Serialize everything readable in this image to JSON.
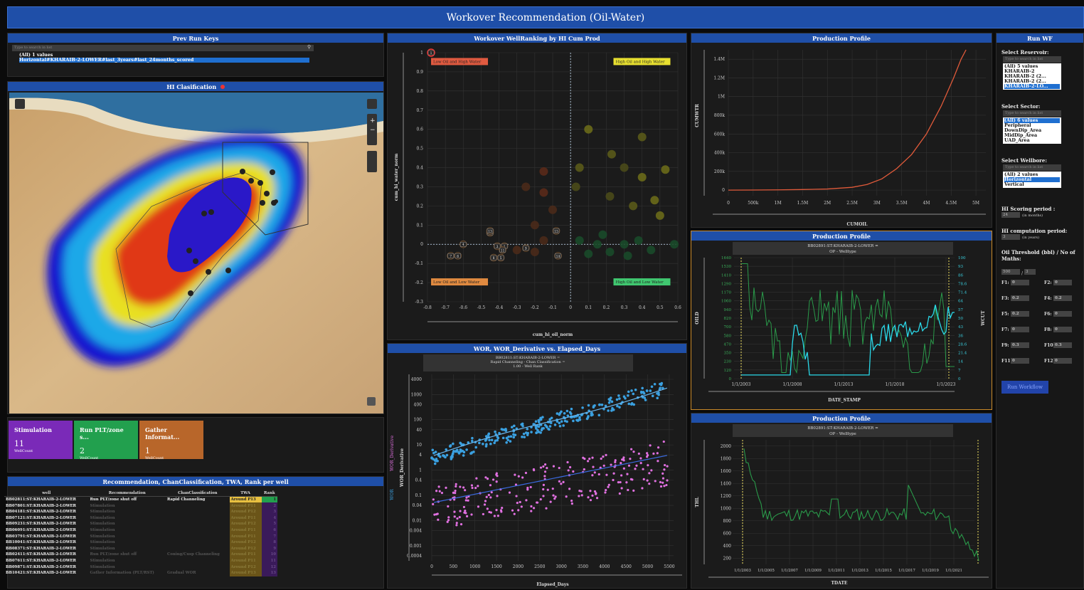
{
  "title": "Workover Recommendation (Oil-Water)",
  "prev_run": {
    "title": "Prev Run Keys",
    "search": "Type to search in list",
    "items": [
      "(All) 1 values",
      "Horizontal#KHARAIB-2-LOWER#last_3years#last_24months_scored"
    ]
  },
  "map": {
    "title": "HI Clasification"
  },
  "cards": [
    {
      "title": "Stimulation",
      "value": "11",
      "sub": "WellCount",
      "color": "#7a2ab8"
    },
    {
      "title": "Run PLT/zone s...",
      "value": "2",
      "sub": "WellCount",
      "color": "#22a04e"
    },
    {
      "title": "Gather Informat...",
      "value": "1",
      "sub": "WellCount",
      "color": "#b8662a"
    }
  ],
  "table": {
    "title": "Recommendation, ChanClassification, TWA, Rank per well",
    "headers": [
      "well",
      "Recommendation",
      "ChanClassification",
      "TWA",
      "Rank"
    ],
    "rows": [
      {
        "well": "BB02811:ST:KHARAIB-2-LOWER",
        "rec": "Run PLT/zone shut off",
        "chan": "Rapid Channeling",
        "twa": "Around P13",
        "rank": "1"
      },
      {
        "well": "BB07801:ST:KHARAIB-2-LOWER",
        "rec": "Stimulation",
        "chan": "",
        "twa": "Around P11",
        "rank": "2"
      },
      {
        "well": "BB04181:ST:KHARAIB-2-LOWER",
        "rec": "Stimulation",
        "chan": "",
        "twa": "Around P12",
        "rank": "3"
      },
      {
        "well": "BB07121:ST:KHARAIB-2-LOWER",
        "rec": "Stimulation",
        "chan": "",
        "twa": "Around P11",
        "rank": "4"
      },
      {
        "well": "BB09231:ST:KHARAIB-2-LOWER",
        "rec": "Stimulation",
        "chan": "",
        "twa": "Around P12",
        "rank": "5"
      },
      {
        "well": "BB06091:ST:KHARAIB-2-LOWER",
        "rec": "Stimulation",
        "chan": "",
        "twa": "Around P11",
        "rank": "6"
      },
      {
        "well": "BB03791:ST:KHARAIB-2-LOWER",
        "rec": "Stimulation",
        "chan": "",
        "twa": "Around P11",
        "rank": "7"
      },
      {
        "well": "BB10041:ST:KHARAIB-2-LOWER",
        "rec": "Stimulation",
        "chan": "",
        "twa": "Around P12",
        "rank": "8"
      },
      {
        "well": "BB08371:ST:KHARAIB-2-LOWER",
        "rec": "Stimulation",
        "chan": "",
        "twa": "Around P12",
        "rank": "9"
      },
      {
        "well": "BB02411:ST:KHARAIB-2-LOWER",
        "rec": "Run PLT/zone shut off",
        "chan": "Coning/Cusp Channeling",
        "twa": "Around P11",
        "rank": "10"
      },
      {
        "well": "BB07611:ST:KHARAIB-2-LOWER",
        "rec": "Stimulation",
        "chan": "",
        "twa": "Around P11",
        "rank": "11"
      },
      {
        "well": "BB09871:ST:KHARAIB-2-LOWER",
        "rec": "Stimulation",
        "chan": "",
        "twa": "Around P12",
        "rank": "12"
      },
      {
        "well": "BB10421:ST:KHARAIB-2-LOWER",
        "rec": "Gather Information (PLT/RST)",
        "chan": "Gradual WOR",
        "twa": "Around P13",
        "rank": "13"
      }
    ]
  },
  "ranking": {
    "title": "Workover WellRanking by HI Cum Prod",
    "xlabel": "cum_hi_oil_norm",
    "ylabel": "cum_hi_water_norm",
    "quadrants": [
      "Low Oil and High Water",
      "High Oil and High Water",
      "Low Oil and Low Water",
      "High Oil and Low Water"
    ],
    "xticks": [
      "-0.8",
      "-0.7",
      "-0.6",
      "-0.5",
      "-0.4",
      "-0.3",
      "-0.2",
      "-0.1",
      "0",
      "0.1",
      "0.2",
      "0.3",
      "0.4",
      "0.5",
      "0.6"
    ],
    "yticks": [
      "1",
      "0.9",
      "0.8",
      "0.7",
      "0.6",
      "0.5",
      "0.4",
      "0.3",
      "0.2",
      "0.1",
      "0",
      "-0.1",
      "-0.2",
      "-0.3"
    ],
    "ranked": [
      {
        "n": "1",
        "x": -0.78,
        "y": 1.0
      },
      {
        "n": "2",
        "x": -0.37,
        "y": -0.01
      },
      {
        "n": "3",
        "x": -0.41,
        "y": -0.01
      },
      {
        "n": "4",
        "x": -0.6,
        "y": 0.0
      },
      {
        "n": "5",
        "x": -0.39,
        "y": -0.07
      },
      {
        "n": "6",
        "x": -0.63,
        "y": -0.06
      },
      {
        "n": "7",
        "x": -0.67,
        "y": -0.06
      },
      {
        "n": "8",
        "x": -0.43,
        "y": -0.07
      },
      {
        "n": "9",
        "x": -0.25,
        "y": -0.02
      },
      {
        "n": "10",
        "x": -0.45,
        "y": 0.06
      },
      {
        "n": "11",
        "x": -0.38,
        "y": -0.03
      },
      {
        "n": "13",
        "x": -0.45,
        "y": 0.07
      },
      {
        "n": "14",
        "x": -0.07,
        "y": -0.06
      },
      {
        "n": "15",
        "x": -0.08,
        "y": 0.07
      }
    ]
  },
  "prod1": {
    "title": "Production Profile",
    "xlabel": "CUMOIL",
    "ylabel": "CUMWTR",
    "xticks": [
      "0",
      "500k",
      "1M",
      "1.5M",
      "2M",
      "2.5M",
      "3M",
      "3.5M",
      "4M",
      "4.5M",
      "5M"
    ],
    "yticks": [
      "0",
      "200k",
      "400k",
      "600k",
      "800k",
      "1M",
      "1.2M",
      "1.4M"
    ],
    "points": [
      [
        0,
        0
      ],
      [
        500000,
        1000
      ],
      [
        1000000,
        3000
      ],
      [
        1500000,
        6000
      ],
      [
        2000000,
        12000
      ],
      [
        2500000,
        30000
      ],
      [
        2800000,
        60000
      ],
      [
        3100000,
        120000
      ],
      [
        3400000,
        230000
      ],
      [
        3700000,
        380000
      ],
      [
        4000000,
        600000
      ],
      [
        4300000,
        900000
      ],
      [
        4550000,
        1200000
      ],
      [
        4700000,
        1400000
      ],
      [
        4800000,
        1500000
      ]
    ]
  },
  "prod2": {
    "title": "Production Profile",
    "subtitle": "BB02891:ST:KHARAIB-2-LOWER =",
    "subtitle2": "OP - Welltype",
    "xlabel": "DATE_STAMP",
    "ylabel": "OILD",
    "ylabel2": "WCUT",
    "xticks": [
      "1/1/2003",
      "1/1/2008",
      "1/1/2013",
      "1/1/2018",
      "1/1/2023"
    ],
    "yticks": [
      "0",
      "120",
      "230",
      "350",
      "470",
      "580",
      "700",
      "820",
      "940",
      "1060",
      "1170",
      "1290",
      "1410",
      "1530",
      "1640"
    ],
    "y2ticks": [
      "0",
      "7",
      "14",
      "21.4",
      "28.6",
      "36",
      "43",
      "50",
      "57",
      "64",
      "71.4",
      "78.6",
      "86",
      "93",
      "100"
    ],
    "markers": [
      "1/1/2003",
      "5/1/2022"
    ]
  },
  "prod3": {
    "title": "Production Profile",
    "subtitle": "BB02891:ST:KHARAIB-2-LOWER =",
    "subtitle2": "OP - Welltype",
    "xlabel": "TDATE",
    "ylabel": "THL",
    "xticks": [
      "1/1/2003",
      "1/1/2005",
      "1/1/2007",
      "1/1/2009",
      "1/1/2011",
      "1/1/2013",
      "1/1/2015",
      "1/1/2017",
      "1/1/2019",
      "1/1/2021"
    ],
    "yticks": [
      "200",
      "400",
      "600",
      "800",
      "1000",
      "1200",
      "1400",
      "1600",
      "1800",
      "2000"
    ],
    "markers": [
      "1/1/2003",
      "1/1/2022"
    ]
  },
  "wor": {
    "title": "WOR, WOR_Derivative vs. Elapsed_Days",
    "subtitle": "BB02811:ST:KHARAIB-2-LOWER =",
    "subtitle2": "Rapid Channeling - Chan Classification =",
    "subtitle3": "1.00 - Well Rank",
    "xlabel": "Elapsed_Days",
    "ylabel": "WOR_Derivative",
    "legend": [
      "WOR",
      "WOR_Derivative"
    ],
    "xticks": [
      "0",
      "500",
      "1000",
      "1500",
      "2000",
      "2500",
      "3000",
      "3500",
      "4000",
      "4500",
      "5000",
      "5500"
    ],
    "yticks": [
      "0.0004",
      "0.001",
      "0.004",
      "0.01",
      "0.04",
      "0.1",
      "0.4",
      "1",
      "4",
      "10",
      "40",
      "100",
      "400",
      "1000",
      "4000"
    ]
  },
  "runwf": {
    "title": "Run WF",
    "reservoir_label": "Select Reservoir:",
    "reservoir_items": [
      "(All) 5 values",
      "KHARAIB-2",
      "KHARAIB-2 (2...",
      "KHARAIB-2 (2...",
      "KHARAIB-2-LO..."
    ],
    "sector_label": "Select Sector:",
    "sector_items": [
      "(All) 6 values",
      "Peripheral",
      "DownDip_Area",
      "MidDip_Area",
      "UAD_Area"
    ],
    "wellbore_label": "Select Wellbore:",
    "wellbore_items": [
      "(All) 2 values",
      "Horizontal",
      "Vertical"
    ],
    "search": "Type to search in list",
    "hi_scoring_label": "HI Scoring period :",
    "hi_scoring_val": "24",
    "hi_scoring_unit": "(in months)",
    "hi_comp_label": "HI computation period:",
    "hi_comp_val": "3",
    "hi_comp_unit": "(in years)",
    "oil_label": "Oil Threshold (bbl) / No of Mnths:",
    "oil_val": "500",
    "oil_months": "3",
    "fields": [
      [
        "F1:",
        "0"
      ],
      [
        "F2:",
        "0"
      ],
      [
        "F3:",
        "0.2"
      ],
      [
        "F4:",
        "0.2"
      ],
      [
        "F5:",
        "0.2"
      ],
      [
        "F6:",
        "0"
      ],
      [
        "F7:",
        "0"
      ],
      [
        "F8:",
        "0"
      ],
      [
        "F9:",
        "0.3"
      ],
      [
        "F10:",
        "0.3"
      ],
      [
        "F11:",
        "0"
      ],
      [
        "F12:",
        "0"
      ]
    ],
    "button": "Run Workflow"
  }
}
